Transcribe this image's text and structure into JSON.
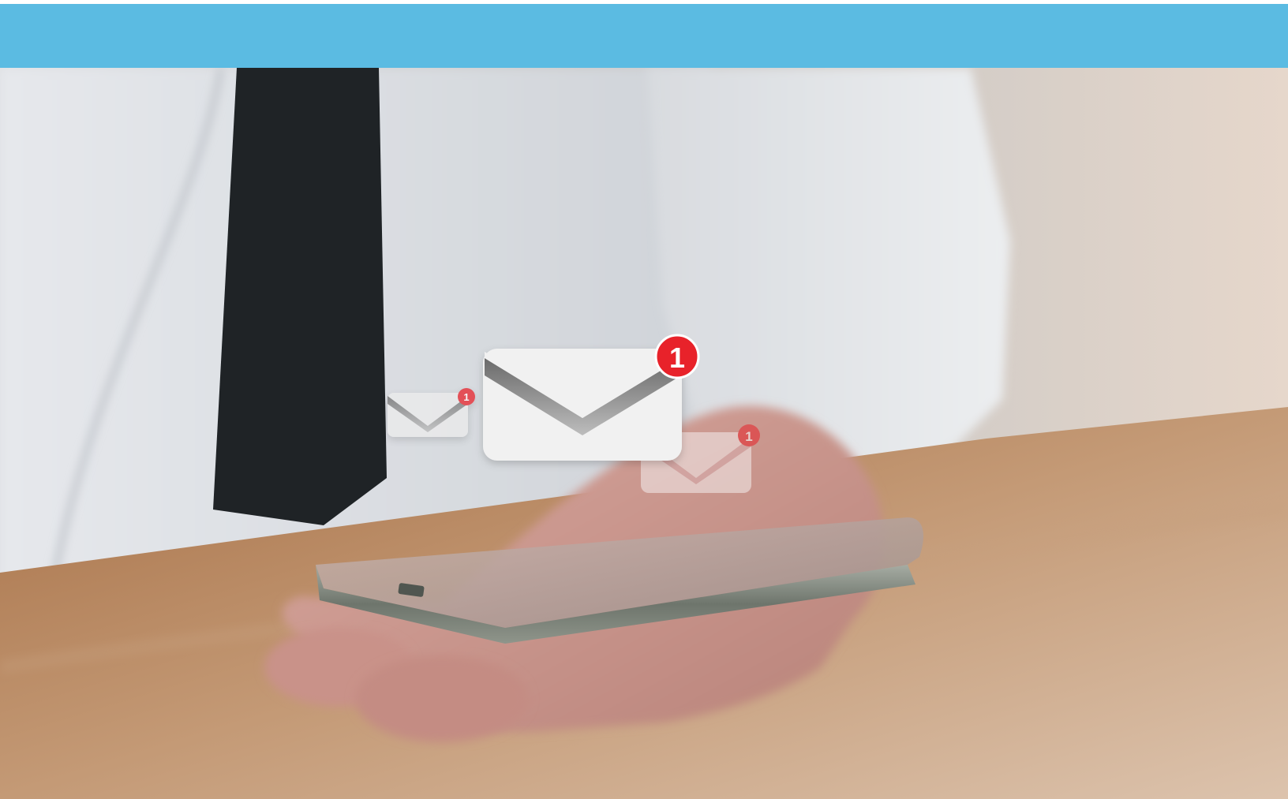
{
  "banner": {
    "color": "#5bbbe2"
  },
  "photo": {
    "subject": "hand-holding-smartphone",
    "icons": {
      "main_envelope": "mail-envelope-icon",
      "left_envelope": "mail-envelope-icon",
      "right_envelope": "mail-envelope-icon"
    },
    "badges": {
      "main": "1",
      "left": "1",
      "right": "1"
    },
    "colors": {
      "badge": "#e8222a",
      "envelope": "#f2f2f2",
      "table": "#b88a63",
      "shirt": "#e3e5e8",
      "tie": "#1e2224",
      "phone": "#7c8178"
    }
  }
}
